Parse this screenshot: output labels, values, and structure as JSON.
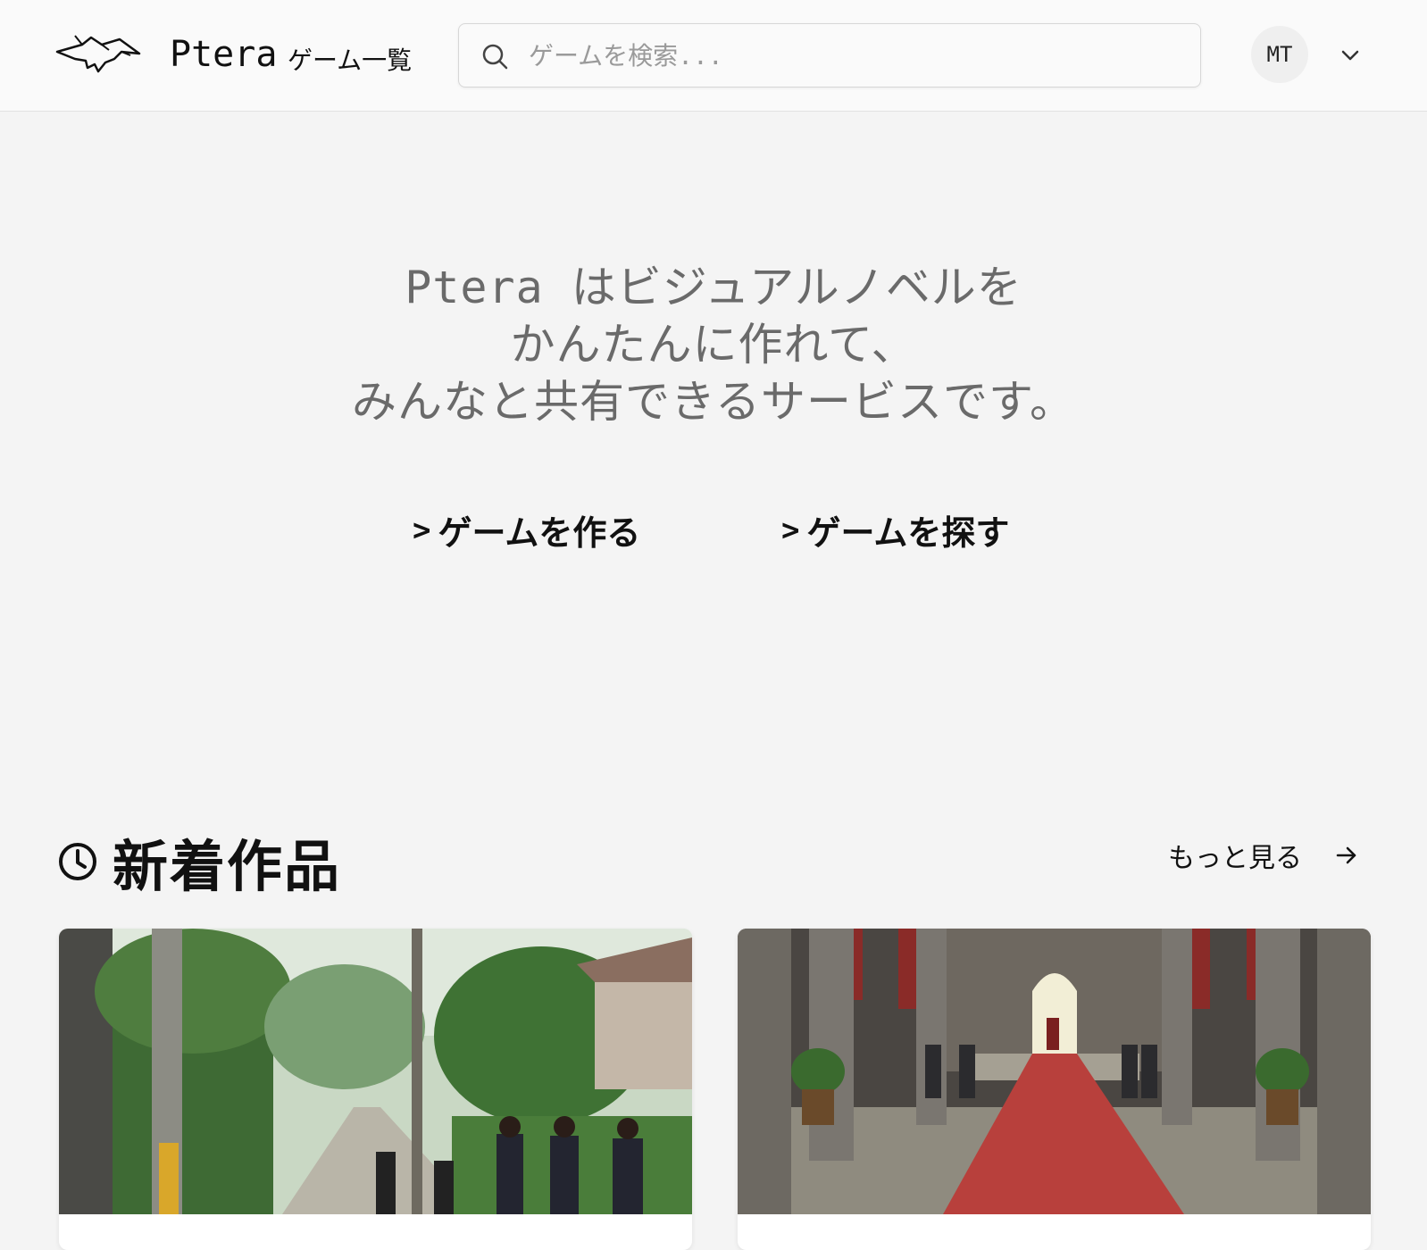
{
  "header": {
    "brand": "Ptera",
    "nav_games_label": "ゲーム一覧",
    "search_placeholder": "ゲームを検索...",
    "avatar_initials": "MT",
    "logo_icon": "pterodactyl-logo-icon",
    "dropdown_icon": "chevron-down-icon"
  },
  "hero": {
    "line1": "Ptera はビジュアルノベルを",
    "line2": "かんたんに作れて、",
    "line3": "みんなと共有できるサービスです。",
    "cta_create": "ゲームを作る",
    "cta_explore": "ゲームを探す",
    "cta_caret": ">"
  },
  "new_works": {
    "title": "新着作品",
    "more_label": "もっと見る",
    "icon": "clock-icon",
    "cards": [
      {
        "image": "suburban-street-students-thumbnail"
      },
      {
        "image": "throne-hall-knights-thumbnail"
      }
    ]
  }
}
